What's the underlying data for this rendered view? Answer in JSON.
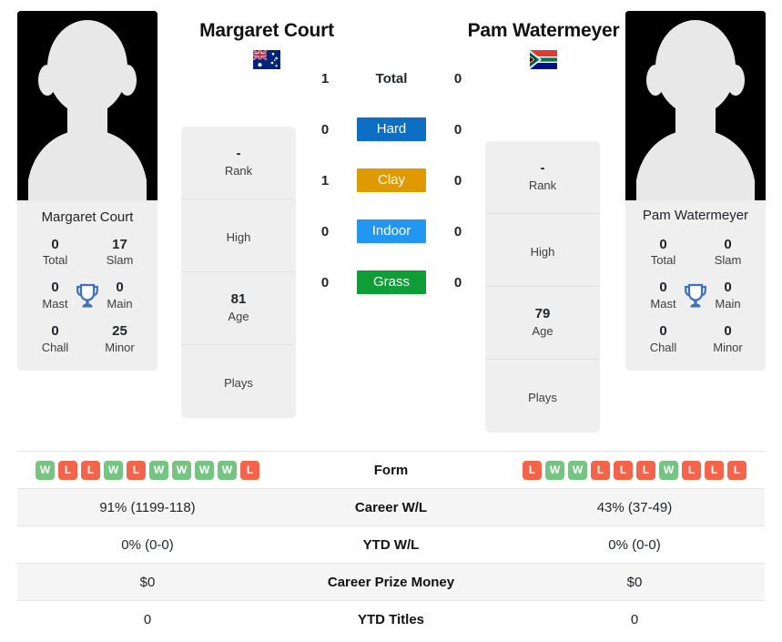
{
  "players": {
    "left": {
      "name": "Margaret Court",
      "photo_caption": "Margaret Court",
      "country": "Australia",
      "flag_icon": "flag-australia-icon",
      "trophies": {
        "total": "0",
        "total_label": "Total",
        "slam": "17",
        "slam_label": "Slam",
        "mast": "0",
        "mast_label": "Mast",
        "main": "0",
        "main_label": "Main",
        "chall": "0",
        "chall_label": "Chall",
        "minor": "25",
        "minor_label": "Minor"
      },
      "info": {
        "rank_value": "-",
        "rank_label": "Rank",
        "high_value": "",
        "high_label": "High",
        "age_value": "81",
        "age_label": "Age",
        "plays_value": "",
        "plays_label": "Plays"
      },
      "form": [
        "W",
        "L",
        "L",
        "W",
        "L",
        "W",
        "W",
        "W",
        "W",
        "L"
      ],
      "career_wl": "91% (1199-118)",
      "ytd_wl": "0% (0-0)",
      "career_prize_money": "$0",
      "ytd_titles": "0"
    },
    "right": {
      "name": "Pam Watermeyer",
      "photo_caption": "Pam Watermeyer",
      "country": "South Africa",
      "flag_icon": "flag-south-africa-icon",
      "trophies": {
        "total": "0",
        "total_label": "Total",
        "slam": "0",
        "slam_label": "Slam",
        "mast": "0",
        "mast_label": "Mast",
        "main": "0",
        "main_label": "Main",
        "chall": "0",
        "chall_label": "Chall",
        "minor": "0",
        "minor_label": "Minor"
      },
      "info": {
        "rank_value": "-",
        "rank_label": "Rank",
        "high_value": "",
        "high_label": "High",
        "age_value": "79",
        "age_label": "Age",
        "plays_value": "",
        "plays_label": "Plays"
      },
      "form": [
        "L",
        "W",
        "W",
        "L",
        "L",
        "L",
        "W",
        "L",
        "L",
        "L"
      ],
      "career_wl": "43% (37-49)",
      "ytd_wl": "0% (0-0)",
      "career_prize_money": "$0",
      "ytd_titles": "0"
    }
  },
  "head_to_head": {
    "rows": [
      {
        "label": "Total",
        "left": "1",
        "right": "0",
        "style": "plain",
        "color": ""
      },
      {
        "label": "Hard",
        "left": "0",
        "right": "0",
        "style": "badge",
        "color": "#0d6fc4"
      },
      {
        "label": "Clay",
        "left": "1",
        "right": "0",
        "style": "badge",
        "color": "#e09a00"
      },
      {
        "label": "Indoor",
        "left": "0",
        "right": "0",
        "style": "badge",
        "color": "#2196f3"
      },
      {
        "label": "Grass",
        "left": "0",
        "right": "0",
        "style": "badge",
        "color": "#0f9d38"
      }
    ]
  },
  "comparison_table": {
    "rows": [
      {
        "label": "Form",
        "type": "form",
        "left": "",
        "right": ""
      },
      {
        "label": "Career W/L",
        "type": "text",
        "left": "91% (1199-118)",
        "right": "43% (37-49)"
      },
      {
        "label": "YTD W/L",
        "type": "text",
        "left": "0% (0-0)",
        "right": "0% (0-0)"
      },
      {
        "label": "Career Prize Money",
        "type": "text",
        "left": "$0",
        "right": "$0"
      },
      {
        "label": "YTD Titles",
        "type": "text",
        "left": "0",
        "right": "0"
      }
    ]
  },
  "colors": {
    "hard": "#0d6fc4",
    "clay": "#e09a00",
    "indoor": "#2196f3",
    "grass": "#0f9d38",
    "win": "#75c482",
    "loss": "#f3644b",
    "trophy": "#4070b8",
    "card_bg": "#efefef"
  }
}
